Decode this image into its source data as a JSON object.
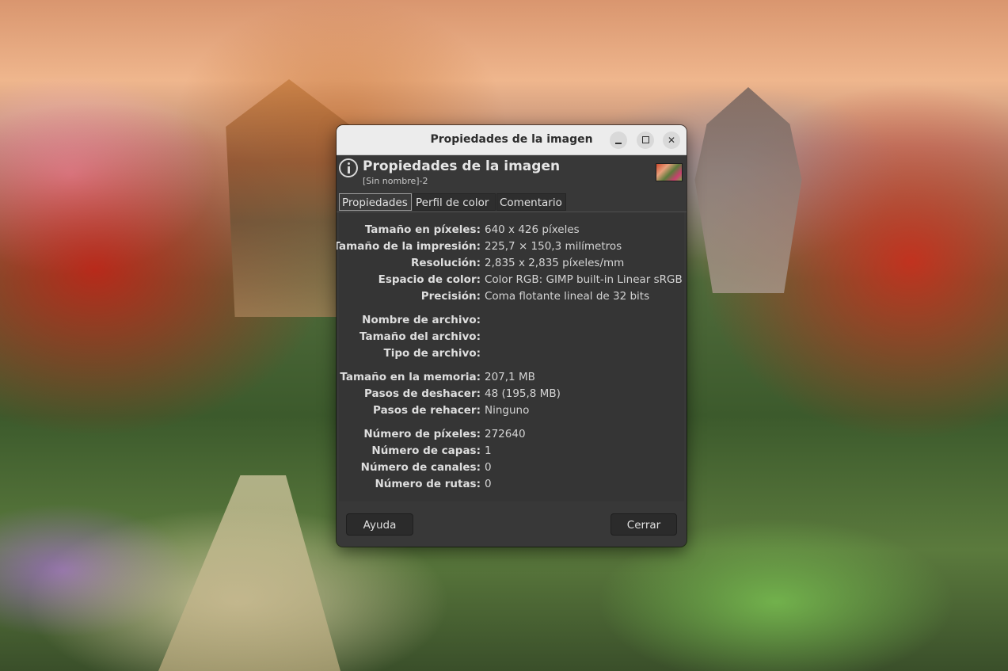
{
  "window": {
    "title": "Propiedades de la imagen",
    "controls": [
      "minimize-icon",
      "maximize-icon",
      "close-icon"
    ]
  },
  "header": {
    "icon": "info-icon",
    "title": "Propiedades de la imagen",
    "subtitle": "[Sin nombre]-2"
  },
  "tabs": [
    {
      "label": "Propiedades",
      "active": true
    },
    {
      "label": "Perfil de color",
      "active": false
    },
    {
      "label": "Comentario",
      "active": false
    }
  ],
  "properties": [
    {
      "label": "Tamaño en píxeles:",
      "value": "640 x 426 píxeles"
    },
    {
      "label": "Tamaño de la impresión:",
      "value": "225,7 × 150,3 milímetros"
    },
    {
      "label": "Resolución:",
      "value": "2,835 x 2,835 píxeles/mm"
    },
    {
      "label": "Espacio de color:",
      "value": "Color RGB: GIMP built-in Linear sRGB"
    },
    {
      "label": "Precisión:",
      "value": "Coma flotante lineal de 32 bits"
    },
    {
      "label": "Nombre de archivo:",
      "value": ""
    },
    {
      "label": "Tamaño del archivo:",
      "value": ""
    },
    {
      "label": "Tipo de archivo:",
      "value": ""
    },
    {
      "label": "Tamaño en la memoria:",
      "value": "207,1 MB"
    },
    {
      "label": "Pasos de deshacer:",
      "value": "48 (195,8 MB)"
    },
    {
      "label": "Pasos de rehacer:",
      "value": "Ninguno"
    },
    {
      "label": "Número de píxeles:",
      "value": "272640"
    },
    {
      "label": "Número de capas:",
      "value": "1"
    },
    {
      "label": "Número de canales:",
      "value": "0"
    },
    {
      "label": "Número de rutas:",
      "value": "0"
    }
  ],
  "buttons": {
    "help": "Ayuda",
    "close": "Cerrar"
  }
}
